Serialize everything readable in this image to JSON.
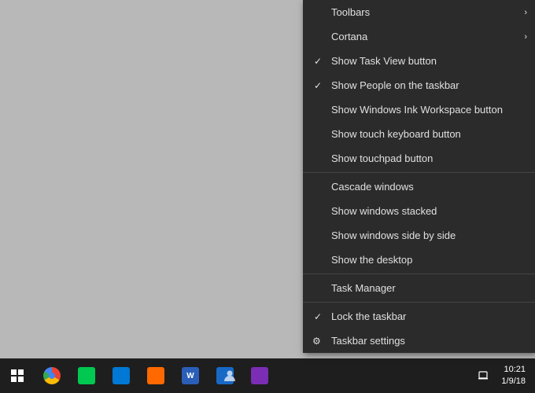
{
  "desktop": {
    "background_color": "#b8b8b8"
  },
  "context_menu": {
    "items": [
      {
        "id": "toolbars",
        "label": "Toolbars",
        "has_arrow": true,
        "checked": false,
        "has_gear": false,
        "separator_before": false
      },
      {
        "id": "cortana",
        "label": "Cortana",
        "has_arrow": true,
        "checked": false,
        "has_gear": false,
        "separator_before": false
      },
      {
        "id": "show-task-view",
        "label": "Show Task View button",
        "has_arrow": false,
        "checked": true,
        "has_gear": false,
        "separator_before": false
      },
      {
        "id": "show-people",
        "label": "Show People on the taskbar",
        "has_arrow": false,
        "checked": true,
        "has_gear": false,
        "separator_before": false
      },
      {
        "id": "show-ink",
        "label": "Show Windows Ink Workspace button",
        "has_arrow": false,
        "checked": false,
        "has_gear": false,
        "separator_before": false
      },
      {
        "id": "show-touch",
        "label": "Show touch keyboard button",
        "has_arrow": false,
        "checked": false,
        "has_gear": false,
        "separator_before": false
      },
      {
        "id": "show-touchpad",
        "label": "Show touchpad button",
        "has_arrow": false,
        "checked": false,
        "has_gear": false,
        "separator_before": false
      },
      {
        "id": "sep1",
        "label": "",
        "separator": true
      },
      {
        "id": "cascade",
        "label": "Cascade windows",
        "has_arrow": false,
        "checked": false,
        "has_gear": false,
        "separator_before": false
      },
      {
        "id": "stacked",
        "label": "Show windows stacked",
        "has_arrow": false,
        "checked": false,
        "has_gear": false,
        "separator_before": false
      },
      {
        "id": "side-by-side",
        "label": "Show windows side by side",
        "has_arrow": false,
        "checked": false,
        "has_gear": false,
        "separator_before": false
      },
      {
        "id": "show-desktop",
        "label": "Show the desktop",
        "has_arrow": false,
        "checked": false,
        "has_gear": false,
        "separator_before": false
      },
      {
        "id": "sep2",
        "label": "",
        "separator": true
      },
      {
        "id": "task-manager",
        "label": "Task Manager",
        "has_arrow": false,
        "checked": false,
        "has_gear": false,
        "separator_before": false
      },
      {
        "id": "sep3",
        "label": "",
        "separator": true
      },
      {
        "id": "lock-taskbar",
        "label": "Lock the taskbar",
        "has_arrow": false,
        "checked": true,
        "has_gear": false,
        "separator_before": false
      },
      {
        "id": "taskbar-settings",
        "label": "Taskbar settings",
        "has_arrow": false,
        "checked": false,
        "has_gear": true,
        "separator_before": false
      }
    ]
  },
  "taskbar": {
    "clock": {
      "time": "10:21",
      "date": "1/9/18"
    }
  }
}
